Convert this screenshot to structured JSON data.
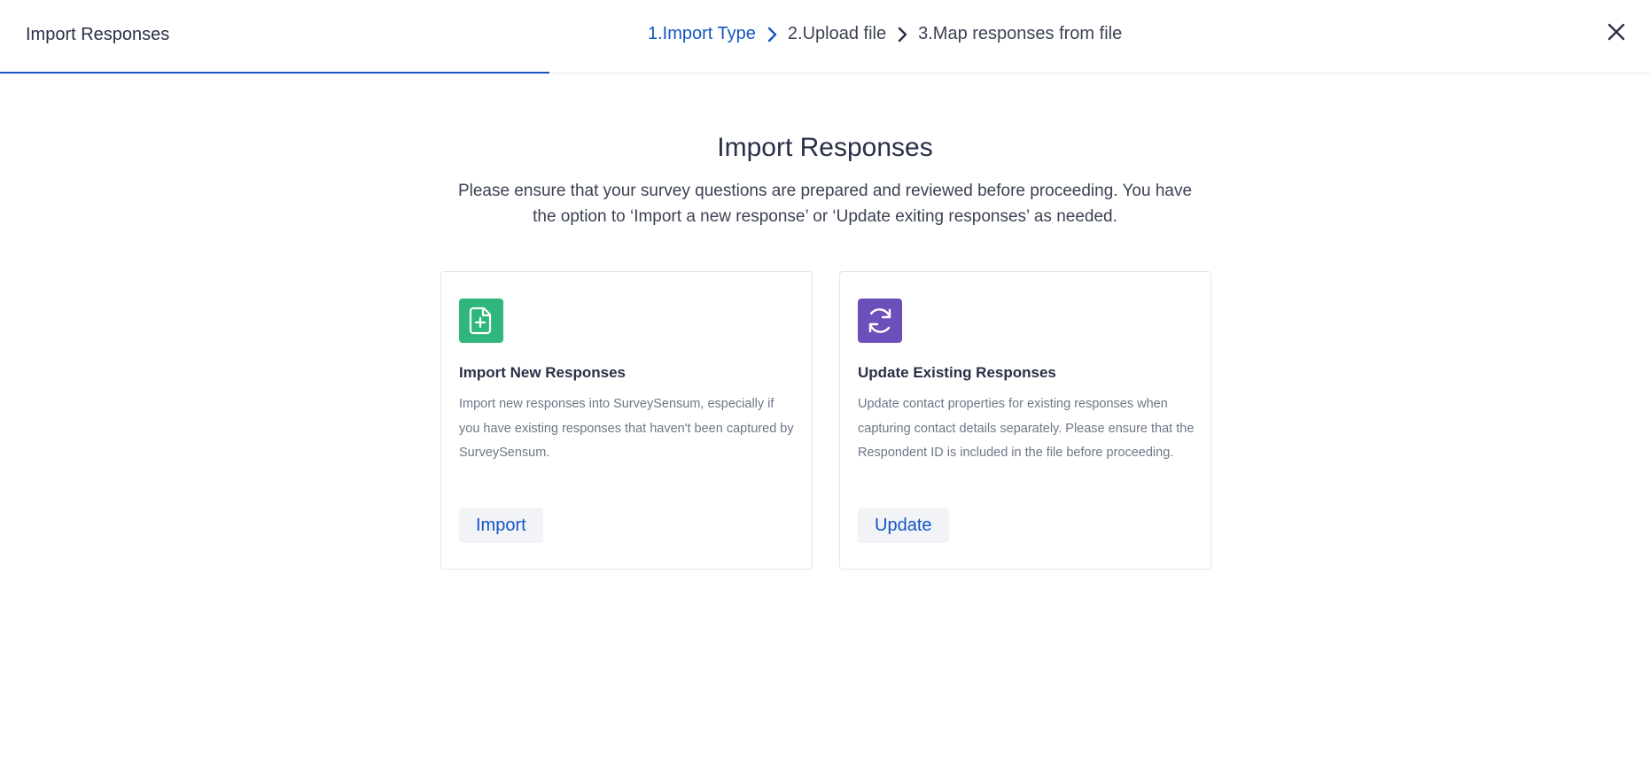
{
  "header": {
    "title": "Import Responses",
    "steps": [
      {
        "label": "1.Import Type",
        "active": true
      },
      {
        "label": "2.Upload file",
        "active": false
      },
      {
        "label": "3.Map responses from file",
        "active": false
      }
    ],
    "progress_fraction": 0.333,
    "close_icon": "close-icon"
  },
  "main": {
    "heading": "Import Responses",
    "description_line1": "Please ensure that your survey questions are prepared and reviewed before proceeding. You have",
    "description_line2": "the option to ‘Import a new response’ or ‘Update exiting responses’ as needed."
  },
  "cards": [
    {
      "icon": "file-plus-icon",
      "icon_color": "#2eb67d",
      "title": "Import New Responses",
      "text": "Import new responses into SurveySensum, especially if you have existing responses that haven't been captured by SurveySensum.",
      "button": "Import"
    },
    {
      "icon": "refresh-icon",
      "icon_color": "#6b4fbb",
      "title": "Update Existing Responses",
      "text": "Update contact properties for existing responses when capturing contact details separately. Please ensure that the Respondent ID is included in the file before proceeding.",
      "button": "Update"
    }
  ],
  "colors": {
    "accent": "#1556c4",
    "text": "#283046",
    "muted": "#6e7687"
  }
}
